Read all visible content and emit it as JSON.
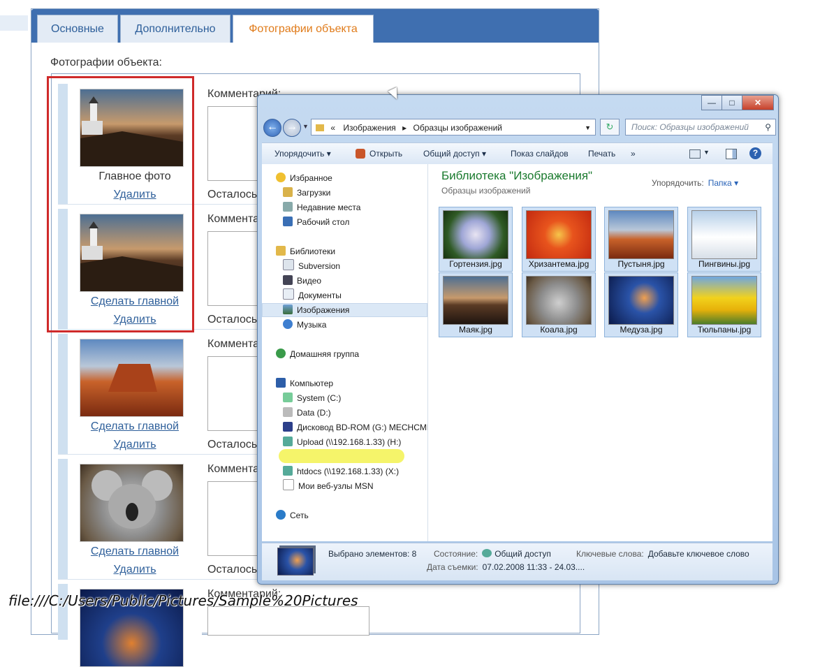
{
  "tabs": [
    "Основные",
    "Дополнительно",
    "Фотографии объекта"
  ],
  "form": {
    "section_label": "Фотографии объекта:",
    "comment_label": "Комментарий:",
    "comment_label_short": "Комментар",
    "remain_label": "Осталось",
    "main_photo_label": "Главное фото",
    "make_main_link": "Сделать главной",
    "delete_link": "Удалить"
  },
  "explorer": {
    "window_buttons": [
      "—",
      "□",
      "✕"
    ],
    "address": [
      "«",
      "Изображения",
      "▸",
      "Образцы изображений"
    ],
    "search_placeholder": "Поиск: Образцы изображений",
    "toolbar": [
      "Упорядочить ▾",
      "Открыть",
      "Общий доступ ▾",
      "Показ слайдов",
      "Печать",
      "»"
    ],
    "nav": {
      "favorites": "Избранное",
      "favorites_items": [
        "Загрузки",
        "Недавние места",
        "Рабочий стол"
      ],
      "libraries": "Библиотеки",
      "libraries_items": [
        "Subversion",
        "Видео",
        "Документы",
        "Изображения",
        "Музыка"
      ],
      "homegroup": "Домашняя группа",
      "computer": "Компьютер",
      "computer_items": [
        "System (C:)",
        "Data (D:)",
        "Дисковод BD-ROM (G:) MECHCMD",
        "Upload (\\\\192.168.1.33) (H:)",
        "htdocs (\\\\192.168.1.33) (X:)",
        "Мои веб-узлы MSN"
      ],
      "network": "Сеть"
    },
    "library_title": "Библиотека \"Изображения\"",
    "library_subtitle": "Образцы изображений",
    "arrange_label": "Упорядочить:",
    "arrange_value": "Папка ▾",
    "files": [
      "Гортензия.jpg",
      "Хризантема.jpg",
      "Пустыня.jpg",
      "Пингвины.jpg",
      "Маяк.jpg",
      "Коала.jpg",
      "Медуза.jpg",
      "Тюльпаны.jpg"
    ],
    "status": {
      "selected": "Выбрано элементов: 8",
      "state_label": "Состояние:",
      "state_value": "Общий доступ",
      "keywords_label": "Ключевые слова:",
      "keywords_value": "Добавьте ключевое слово",
      "date_label": "Дата съемки:",
      "date_value": "07.02.2008 11:33 - 24.03...."
    }
  },
  "url_overlay": "file:///C:/Users/Public/Pictures/Sample%20Pictures",
  "colors": {
    "tab_active_text": "#e07b1a",
    "tab_text": "#2e5f9a",
    "highlight": "#cf2a2a",
    "library_title": "#1a7a2e"
  }
}
